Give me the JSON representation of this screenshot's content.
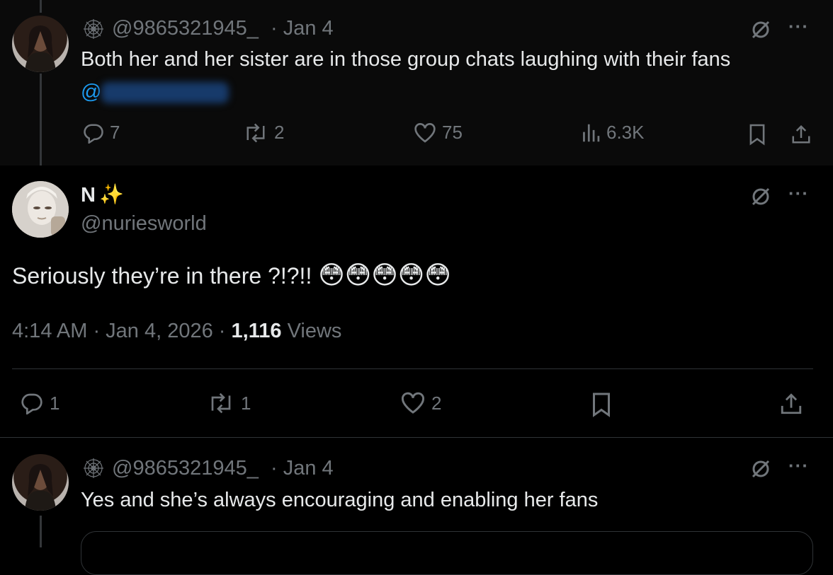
{
  "reply_top": {
    "handle": "@9865321945_",
    "date": "· Jan 4",
    "text": "Both her and her sister are in those group chats laughing with their fans",
    "mention_prefix": "@",
    "stats": {
      "replies": "7",
      "reposts": "2",
      "likes": "75",
      "views": "6.3K"
    }
  },
  "main_post": {
    "display_name": "N",
    "display_emoji": "✨",
    "handle": "@nuriesworld",
    "text": "Seriously they’re in there ?!?!!",
    "emojis": "😳😳😳😳😳",
    "time": "4:14 AM · Jan 4, 2026 ·",
    "view_count": "1,116",
    "views_label": "Views",
    "stats": {
      "replies": "1",
      "reposts": "1",
      "likes": "2"
    }
  },
  "reply_bottom": {
    "handle": "@9865321945_",
    "date": "· Jan 4",
    "text": "Yes and she’s always encouraging and enabling her fans"
  },
  "more_glyph": "···",
  "colors": {
    "background": "#000000",
    "top_background": "#0a0a0a",
    "text": "#e7e9ea",
    "muted": "#71767b",
    "link": "#1d9bf0",
    "divider": "#2f3336"
  }
}
